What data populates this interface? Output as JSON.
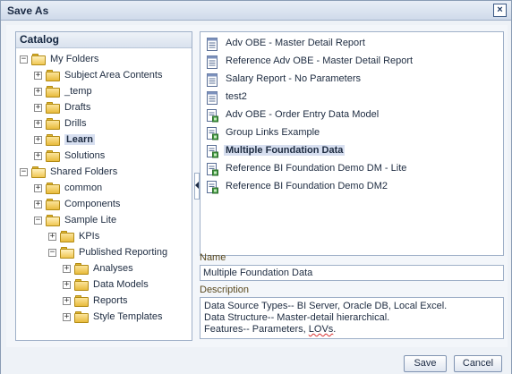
{
  "dialog": {
    "title": "Save As",
    "close_label": "×"
  },
  "catalog": {
    "header": "Catalog",
    "tree": [
      {
        "label": "My Folders",
        "depth": 0,
        "expanded": true,
        "selected": false
      },
      {
        "label": "Subject Area Contents",
        "depth": 1,
        "expanded": false,
        "selected": false
      },
      {
        "label": "_temp",
        "depth": 1,
        "expanded": false,
        "selected": false
      },
      {
        "label": "Drafts",
        "depth": 1,
        "expanded": false,
        "selected": false
      },
      {
        "label": "Drills",
        "depth": 1,
        "expanded": false,
        "selected": false
      },
      {
        "label": "Learn",
        "depth": 1,
        "expanded": false,
        "selected": true
      },
      {
        "label": "Solutions",
        "depth": 1,
        "expanded": false,
        "selected": false
      },
      {
        "label": "Shared Folders",
        "depth": 0,
        "expanded": true,
        "selected": false
      },
      {
        "label": "common",
        "depth": 1,
        "expanded": false,
        "selected": false
      },
      {
        "label": "Components",
        "depth": 1,
        "expanded": false,
        "selected": false
      },
      {
        "label": "Sample Lite",
        "depth": 1,
        "expanded": true,
        "selected": false
      },
      {
        "label": "KPIs",
        "depth": 2,
        "expanded": false,
        "selected": false
      },
      {
        "label": "Published Reporting",
        "depth": 2,
        "expanded": true,
        "selected": false
      },
      {
        "label": "Analyses",
        "depth": 3,
        "expanded": false,
        "selected": false
      },
      {
        "label": "Data Models",
        "depth": 3,
        "expanded": false,
        "selected": false
      },
      {
        "label": "Reports",
        "depth": 3,
        "expanded": false,
        "selected": false
      },
      {
        "label": "Style Templates",
        "depth": 3,
        "expanded": false,
        "selected": false
      }
    ]
  },
  "files": [
    {
      "label": "Adv OBE - Master Detail Report",
      "icon": "report-icon",
      "selected": false
    },
    {
      "label": "Reference Adv OBE - Master Detail Report",
      "icon": "report-icon",
      "selected": false
    },
    {
      "label": "Salary Report - No Parameters",
      "icon": "report-icon",
      "selected": false
    },
    {
      "label": "test2",
      "icon": "report-icon",
      "selected": false
    },
    {
      "label": "Adv OBE - Order Entry Data Model",
      "icon": "data-model-icon",
      "selected": false
    },
    {
      "label": "Group Links Example",
      "icon": "data-model-icon",
      "selected": false
    },
    {
      "label": "Multiple Foundation Data",
      "icon": "data-model-icon",
      "selected": true
    },
    {
      "label": "Reference BI Foundation Demo DM - Lite",
      "icon": "data-model-icon",
      "selected": false
    },
    {
      "label": "Reference BI Foundation Demo DM2",
      "icon": "data-model-icon",
      "selected": false
    }
  ],
  "form": {
    "name_label": "Name",
    "name_value": "Multiple Foundation Data",
    "description_label": "Description",
    "description_lines": [
      "Data Source Types-- BI Server, Oracle DB, Local Excel.",
      "Data Structure-- Master-detail hierarchical.",
      "Features-- Parameters, "
    ],
    "description_squiggle": "LOVs",
    "description_tail": "."
  },
  "buttons": {
    "save": "Save",
    "cancel": "Cancel"
  },
  "colors": {
    "accent": "#d7dff0",
    "border": "#9fb0c8",
    "folder": "#e8bb3c",
    "label_brown": "#5b4a1f"
  }
}
